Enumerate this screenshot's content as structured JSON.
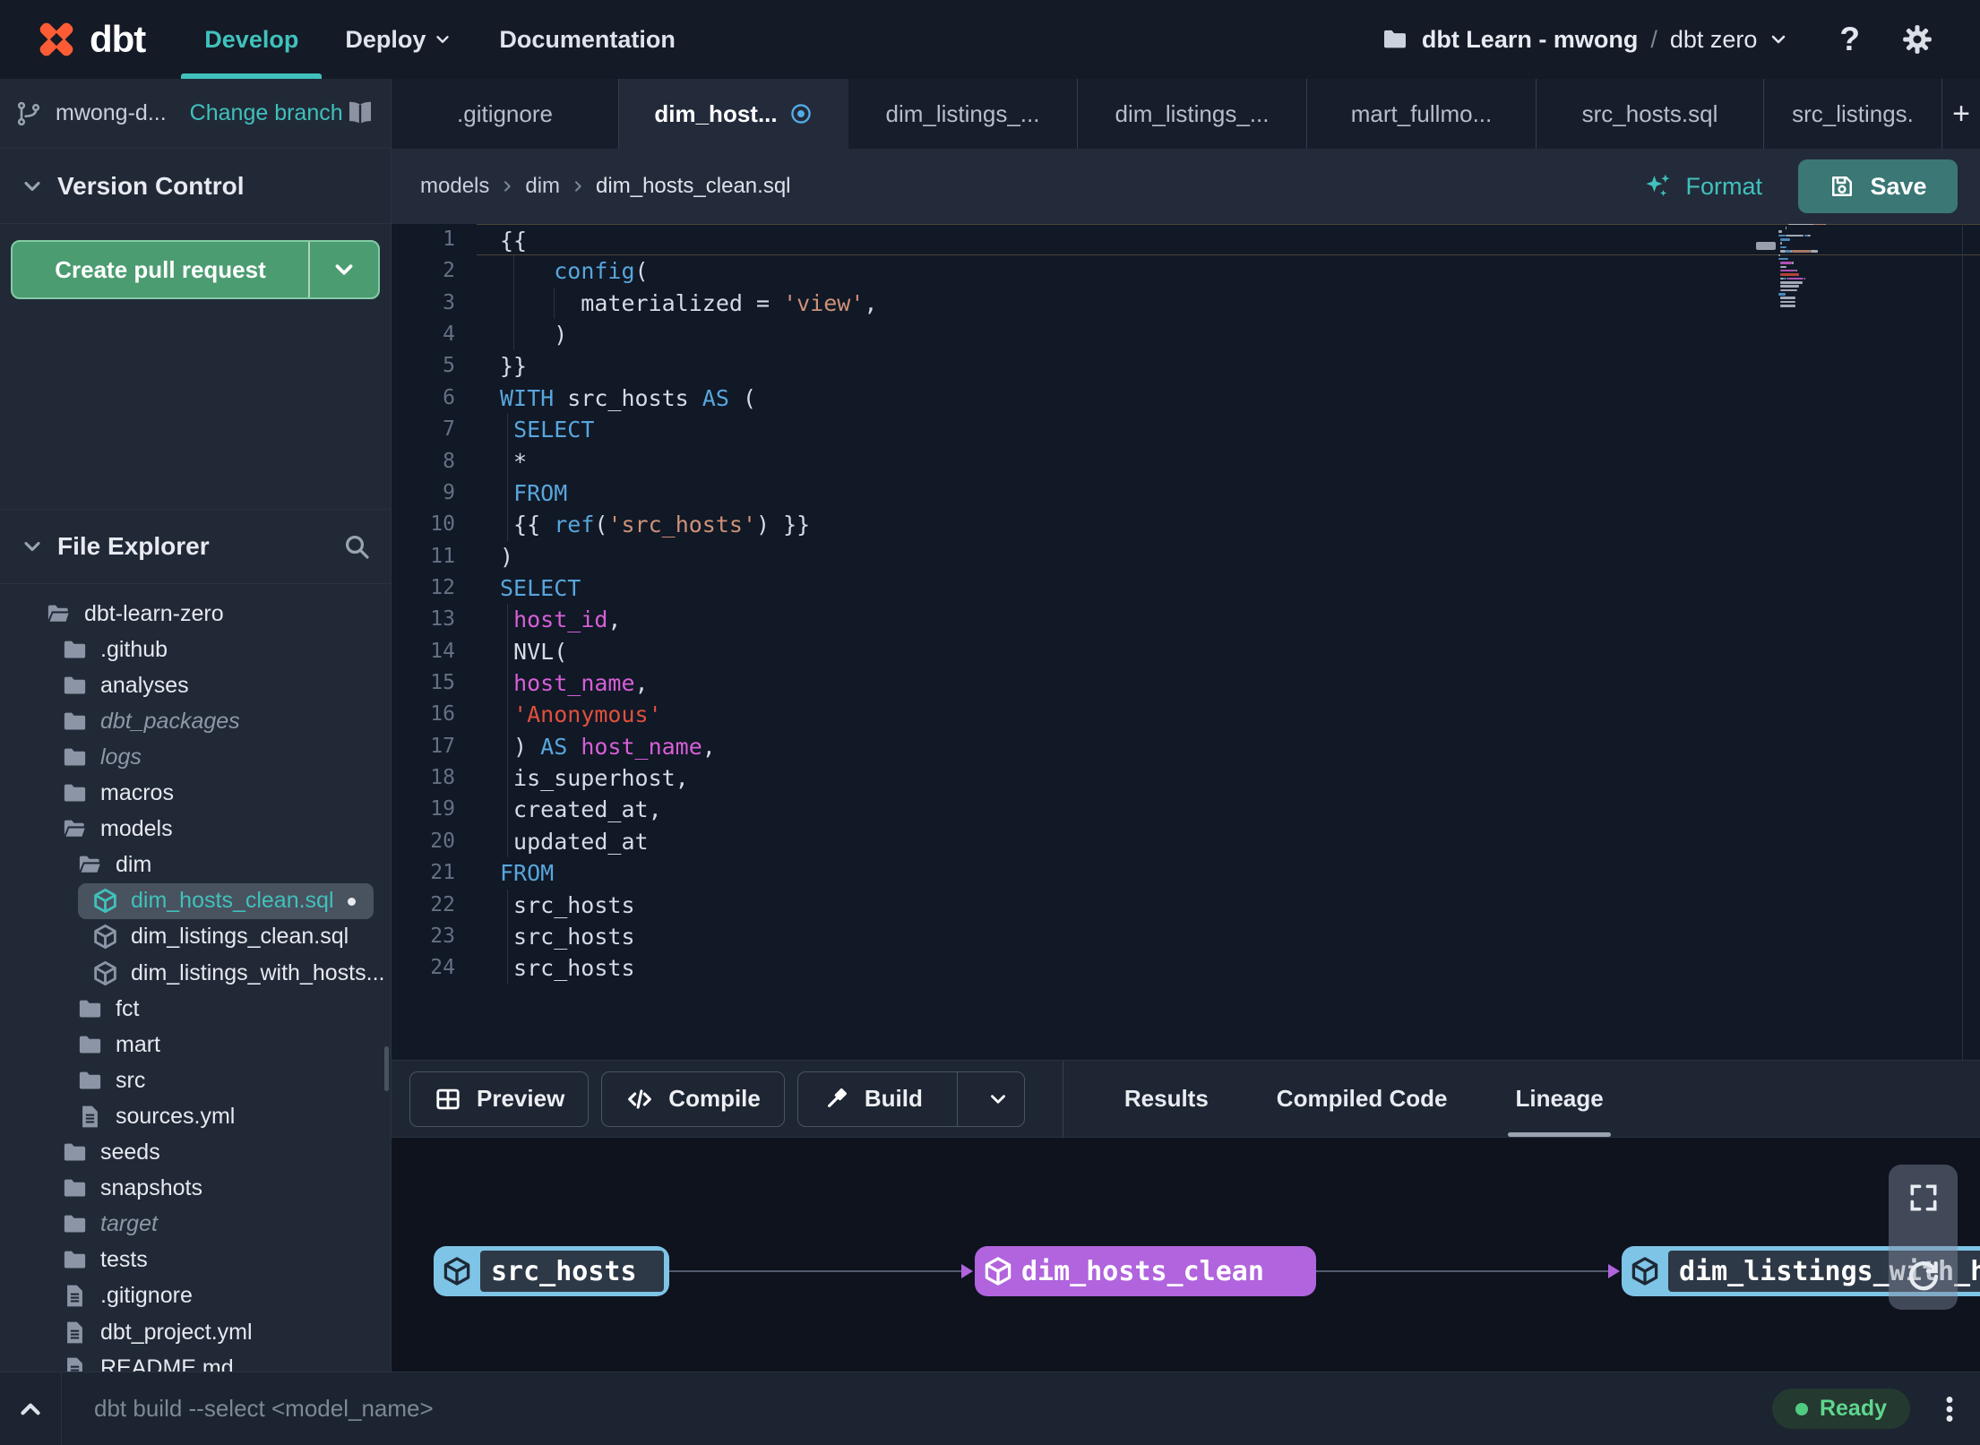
{
  "colors": {
    "accent": "#40C1BC",
    "logo_orange": "#FF5C35",
    "pr_green": "#4C9C71",
    "save_teal": "#3A7775",
    "node_blue": "#7EC4E6",
    "node_purple": "#B164DD",
    "tab_dirty_blue": "#54AEE4",
    "ready_green": "#5FD68F",
    "syntax_keyword": "#58A6DC",
    "syntax_string": "#CE9178",
    "syntax_string_red": "#E0503C",
    "syntax_identifier": "#D75FD7"
  },
  "nav": {
    "brand": "dbt",
    "items": [
      {
        "label": "Develop",
        "active": true
      },
      {
        "label": "Deploy",
        "chevron": true
      },
      {
        "label": "Documentation"
      }
    ],
    "project_name": "dbt Learn - mwong",
    "project_sep": "/",
    "project_env": "dbt zero",
    "help": "?"
  },
  "branch_bar": {
    "branch": "mwong-d...",
    "change": "Change branch"
  },
  "version_control": {
    "title": "Version Control",
    "create_pr": "Create pull request"
  },
  "file_explorer": {
    "title": "File Explorer",
    "tree": [
      {
        "label": "dbt-learn-zero",
        "icon": "folder-open-icon",
        "level": 0
      },
      {
        "label": ".github",
        "icon": "folder-icon",
        "level": 1
      },
      {
        "label": "analyses",
        "icon": "folder-icon",
        "level": 1
      },
      {
        "label": "dbt_packages",
        "icon": "folder-icon",
        "level": 1,
        "italic": true
      },
      {
        "label": "logs",
        "icon": "folder-icon",
        "level": 1,
        "italic": true
      },
      {
        "label": "macros",
        "icon": "folder-icon",
        "level": 1
      },
      {
        "label": "models",
        "icon": "folder-open-icon",
        "level": 1
      },
      {
        "label": "dim",
        "icon": "folder-open-icon",
        "level": 2
      },
      {
        "label": "dim_hosts_clean.sql",
        "icon": "model-cube-icon",
        "level": 3,
        "selected": true,
        "dirty": true
      },
      {
        "label": "dim_listings_clean.sql",
        "icon": "model-cube-icon",
        "level": 3
      },
      {
        "label": "dim_listings_with_hosts...",
        "icon": "model-cube-icon",
        "level": 3
      },
      {
        "label": "fct",
        "icon": "folder-icon",
        "level": 2
      },
      {
        "label": "mart",
        "icon": "folder-icon",
        "level": 2
      },
      {
        "label": "src",
        "icon": "folder-icon",
        "level": 2
      },
      {
        "label": "sources.yml",
        "icon": "file-icon",
        "level": 2
      },
      {
        "label": "seeds",
        "icon": "folder-icon",
        "level": 1
      },
      {
        "label": "snapshots",
        "icon": "folder-icon",
        "level": 1
      },
      {
        "label": "target",
        "icon": "folder-icon",
        "level": 1,
        "italic": true
      },
      {
        "label": "tests",
        "icon": "folder-icon",
        "level": 1
      },
      {
        "label": ".gitignore",
        "icon": "file-icon",
        "level": 1
      },
      {
        "label": "dbt_project.yml",
        "icon": "file-icon",
        "level": 1
      },
      {
        "label": "README.md",
        "icon": "file-icon",
        "level": 1
      }
    ]
  },
  "tabs": {
    "items": [
      {
        "label": ".gitignore"
      },
      {
        "label": "dim_host...",
        "active": true,
        "dirty": true
      },
      {
        "label": "dim_listings_..."
      },
      {
        "label": "dim_listings_..."
      },
      {
        "label": "mart_fullmo..."
      },
      {
        "label": "src_hosts.sql"
      },
      {
        "label": "src_listings."
      }
    ],
    "new_tab": "+"
  },
  "breadcrumb": {
    "items": [
      "models",
      "dim",
      "dim_hosts_clean.sql"
    ]
  },
  "editor_header": {
    "format": "Format",
    "save": "Save"
  },
  "editor": {
    "current_line": 1,
    "lines": [
      {
        "g": [],
        "s": [
          [
            "p",
            "{{"
          ]
        ]
      },
      {
        "g": [
          1
        ],
        "s": [
          [
            "p",
            "    "
          ],
          [
            "k",
            "config"
          ],
          [
            "p",
            "("
          ]
        ]
      },
      {
        "g": [
          1,
          4
        ],
        "s": [
          [
            "p",
            "      materialized = "
          ],
          [
            "s",
            "'view'"
          ],
          [
            "p",
            ","
          ]
        ]
      },
      {
        "g": [
          1
        ],
        "s": [
          [
            "p",
            "    )"
          ]
        ]
      },
      {
        "g": [],
        "s": [
          [
            "p",
            "}}"
          ]
        ]
      },
      {
        "g": [],
        "s": [
          [
            "k",
            "WITH"
          ],
          [
            "p",
            " src_hosts "
          ],
          [
            "k",
            "AS"
          ],
          [
            "p",
            " ("
          ]
        ]
      },
      {
        "g": [
          0.5
        ],
        "s": [
          [
            "p",
            " "
          ],
          [
            "k",
            "SELECT"
          ]
        ]
      },
      {
        "g": [
          0.5
        ],
        "s": [
          [
            "p",
            " *"
          ]
        ]
      },
      {
        "g": [
          0.5
        ],
        "s": [
          [
            "p",
            " "
          ],
          [
            "k",
            "FROM"
          ]
        ]
      },
      {
        "g": [
          0.5
        ],
        "s": [
          [
            "p",
            " {{ "
          ],
          [
            "k",
            "ref"
          ],
          [
            "p",
            "("
          ],
          [
            "s",
            "'src_hosts'"
          ],
          [
            "p",
            ") }}"
          ]
        ]
      },
      {
        "g": [],
        "s": [
          [
            "p",
            ")"
          ]
        ]
      },
      {
        "g": [],
        "s": [
          [
            "k",
            "SELECT"
          ]
        ]
      },
      {
        "g": [
          0.5
        ],
        "s": [
          [
            "p",
            " "
          ],
          [
            "m",
            "host_id"
          ],
          [
            "p",
            ","
          ]
        ]
      },
      {
        "g": [
          0.5
        ],
        "s": [
          [
            "p",
            " NVL("
          ]
        ]
      },
      {
        "g": [
          0.5
        ],
        "s": [
          [
            "p",
            " "
          ],
          [
            "m",
            "host_name"
          ],
          [
            "p",
            ","
          ]
        ]
      },
      {
        "g": [
          0.5
        ],
        "s": [
          [
            "p",
            " "
          ],
          [
            "r",
            "'Anonymous'"
          ]
        ]
      },
      {
        "g": [
          0.5
        ],
        "s": [
          [
            "p",
            " ) "
          ],
          [
            "k",
            "AS"
          ],
          [
            "p",
            " "
          ],
          [
            "m",
            "host_name"
          ],
          [
            "p",
            ","
          ]
        ]
      },
      {
        "g": [
          0.5
        ],
        "s": [
          [
            "p",
            " is_superhost,"
          ]
        ]
      },
      {
        "g": [
          0.5
        ],
        "s": [
          [
            "p",
            " created_at,"
          ]
        ]
      },
      {
        "g": [
          0.5
        ],
        "s": [
          [
            "p",
            " updated_at"
          ]
        ]
      },
      {
        "g": [],
        "s": [
          [
            "k",
            "FROM"
          ]
        ]
      },
      {
        "g": [
          0.5
        ],
        "s": [
          [
            "p",
            " src_hosts"
          ]
        ]
      },
      {
        "g": [
          0.5
        ],
        "s": [
          [
            "p",
            " src_hosts"
          ]
        ]
      },
      {
        "g": [
          0.5
        ],
        "s": [
          [
            "p",
            " src_hosts"
          ]
        ]
      }
    ]
  },
  "action_bar": {
    "buttons": [
      {
        "label": "Preview",
        "icon": "preview-grid-icon"
      },
      {
        "label": "Compile",
        "icon": "compile-code-icon"
      },
      {
        "label": "Build",
        "icon": "build-hammer-icon",
        "split": true
      }
    ],
    "tabs": [
      {
        "label": "Results"
      },
      {
        "label": "Compiled Code"
      },
      {
        "label": "Lineage",
        "active": true
      }
    ]
  },
  "lineage": {
    "nodes": [
      {
        "label": "src_hosts",
        "kind": "source"
      },
      {
        "label": "dim_hosts_clean",
        "kind": "model"
      },
      {
        "label": "dim_listings_with_h",
        "kind": "source"
      }
    ]
  },
  "status_bar": {
    "command": "dbt build --select <model_name>",
    "ready": "Ready"
  }
}
